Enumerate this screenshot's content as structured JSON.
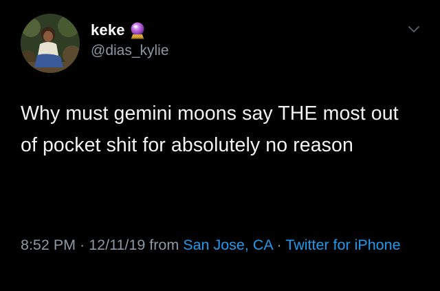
{
  "user": {
    "display_name": "keke",
    "handle": "@dias_kylie",
    "name_emoji": "crystal-ball-icon"
  },
  "tweet": {
    "text": "Why must gemini moons say THE most out of pocket shit for absolutely no reason"
  },
  "meta": {
    "time": "8:52 PM",
    "separator1": " · ",
    "date": "12/11/19",
    "from_word": " from ",
    "location": "San Jose, CA",
    "separator2": " · ",
    "source": "Twitter for iPhone"
  },
  "colors": {
    "background": "#000000",
    "text": "#f2f2f2",
    "secondary": "#8b98a5",
    "link": "#1d9bf0"
  }
}
